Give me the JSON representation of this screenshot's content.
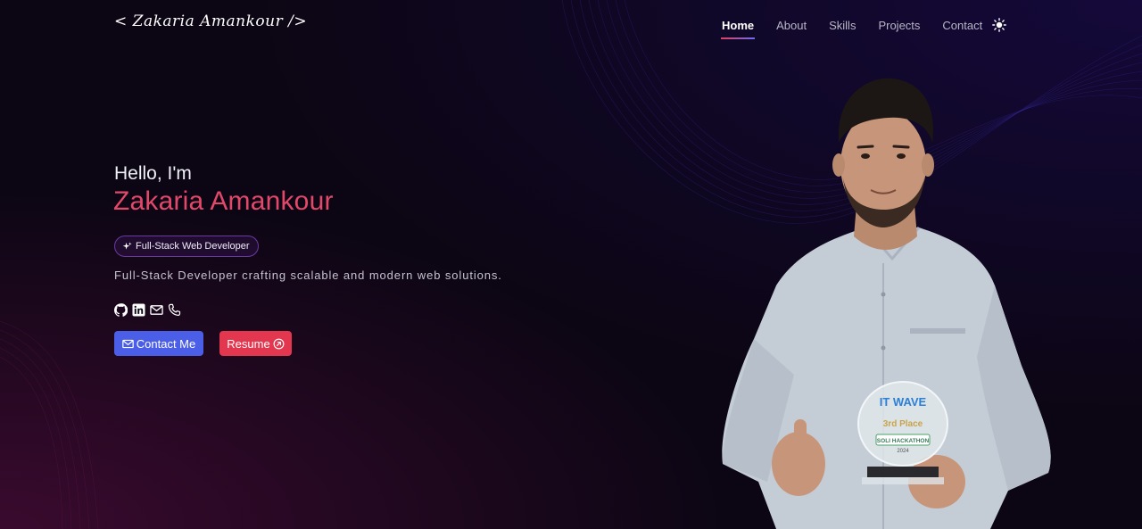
{
  "nav": {
    "logo": "< Zakaria Amankour />",
    "links": [
      {
        "label": "Home",
        "active": true
      },
      {
        "label": "About",
        "active": false
      },
      {
        "label": "Skills",
        "active": false
      },
      {
        "label": "Projects",
        "active": false
      },
      {
        "label": "Contact",
        "active": false
      }
    ],
    "theme_icon": "sun-icon"
  },
  "hero": {
    "greeting": "Hello, I'm",
    "name": "Zakaria Amankour",
    "badge": "Full-Stack Web Developer",
    "badge_icon": "sparkle-icon",
    "tagline": "Full-Stack Developer crafting scalable and modern web solutions.",
    "socials": [
      "github-icon",
      "linkedin-icon",
      "mail-icon",
      "phone-icon"
    ],
    "contact_button": "Contact Me",
    "resume_button": "Resume"
  },
  "trophy": {
    "brand": "IT WAVE",
    "place": "3rd Place",
    "event": "SOLI HACKATHON",
    "year": "2024"
  },
  "colors": {
    "background": "#0c0614",
    "accent_name": "#e2486a",
    "contact_button": "#4a5ee8",
    "resume_button": "#e3364f",
    "badge_border": "#6b3aa5"
  }
}
